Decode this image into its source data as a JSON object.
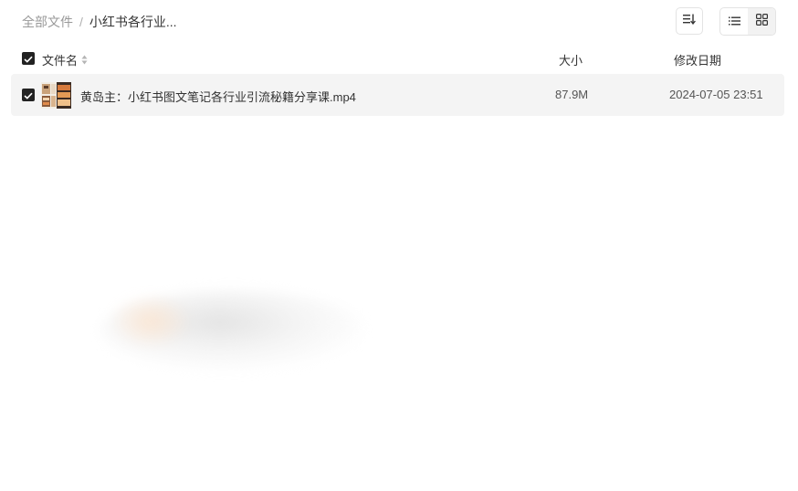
{
  "breadcrumb": {
    "root": "全部文件",
    "separator": "/",
    "current": "小红书各行业..."
  },
  "toolbar": {
    "sort_icon": "sort-list-icon",
    "list_view_icon": "list-view-icon",
    "grid_view_icon": "grid-view-icon",
    "active_view": "grid"
  },
  "table": {
    "columns": {
      "name": "文件名",
      "size": "大小",
      "modified": "修改日期"
    },
    "rows": [
      {
        "checked": true,
        "thumbnail": "video-thumbnail-icon",
        "name": "黄岛主：小红书图文笔记各行业引流秘籍分享课.mp4",
        "size": "87.9M",
        "modified": "2024-07-05 23:51"
      }
    ]
  },
  "colors": {
    "checkbox": "#222222",
    "row_highlight": "#f4f4f4",
    "muted_text": "#999999"
  }
}
